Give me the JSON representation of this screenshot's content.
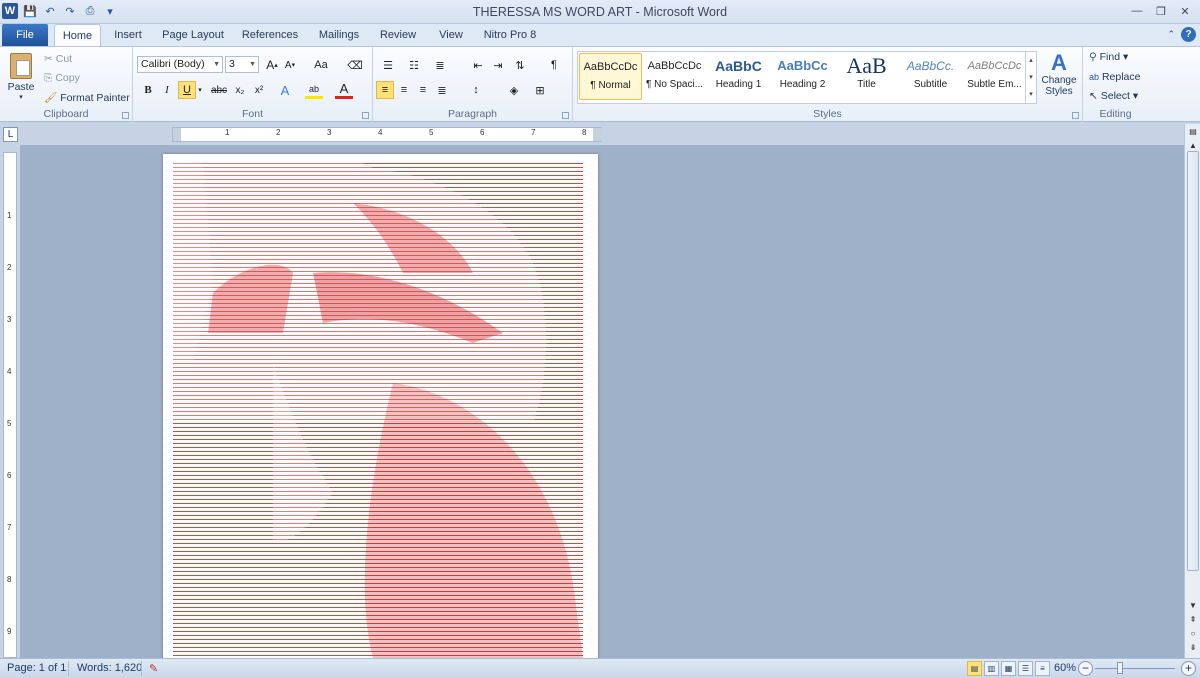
{
  "window": {
    "title": "THERESSA MS WORD ART - Microsoft Word"
  },
  "qat": {
    "logo": "W",
    "save_icon": "floppy-icon",
    "undo_icon": "undo-icon",
    "redo_icon": "redo-icon",
    "preview_icon": "print-preview-icon"
  },
  "tabs": [
    {
      "label": "File"
    },
    {
      "label": "Home"
    },
    {
      "label": "Insert"
    },
    {
      "label": "Page Layout"
    },
    {
      "label": "References"
    },
    {
      "label": "Mailings"
    },
    {
      "label": "Review"
    },
    {
      "label": "View"
    },
    {
      "label": "Nitro Pro 8"
    }
  ],
  "clipboard": {
    "paste": "Paste",
    "cut": "Cut",
    "copy": "Copy",
    "format_painter": "Format Painter",
    "group": "Clipboard"
  },
  "font": {
    "name": "Calibri (Body)",
    "size": "3",
    "group": "Font",
    "bold": "B",
    "italic": "I",
    "underline": "U",
    "strike": "abc",
    "sub": "x₂",
    "sup": "x²",
    "grow": "A",
    "shrink": "A",
    "case": "Aa"
  },
  "paragraph": {
    "group": "Paragraph",
    "pilcrow": "¶"
  },
  "styles": {
    "group": "Styles",
    "items": [
      {
        "preview": "AaBbCcDc",
        "name": "¶ Normal"
      },
      {
        "preview": "AaBbCcDc",
        "name": "¶ No Spaci..."
      },
      {
        "preview": "AaBbC",
        "name": "Heading 1"
      },
      {
        "preview": "AaBbCc",
        "name": "Heading 2"
      },
      {
        "preview": "AaB",
        "name": "Title"
      },
      {
        "preview": "AaBbCc.",
        "name": "Subtitle"
      },
      {
        "preview": "AaBbCcDc",
        "name": "Subtle Em..."
      }
    ],
    "change": "Change Styles"
  },
  "editing": {
    "group": "Editing",
    "find": "Find",
    "replace": "Replace",
    "select": "Select"
  },
  "ruler": {
    "h_marks": [
      "1",
      "2",
      "3",
      "4",
      "5",
      "6",
      "7",
      "8"
    ],
    "v_marks": [
      "1",
      "2",
      "3",
      "4",
      "5",
      "6",
      "7",
      "8",
      "9"
    ]
  },
  "status": {
    "page": "Page: 1 of 1",
    "words": "Words: 1,620",
    "zoom": "60%"
  },
  "colors": {
    "art_red": "#e84040",
    "accent": "#2b579a"
  }
}
